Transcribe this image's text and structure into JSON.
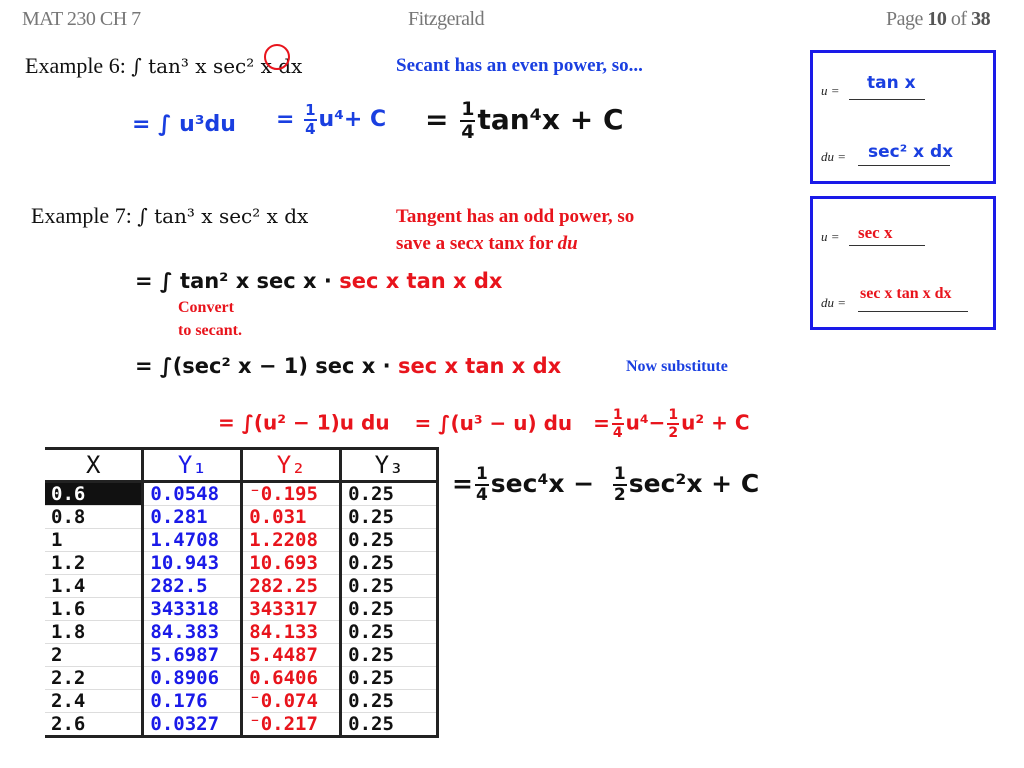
{
  "header": {
    "course": "MAT 230 CH 7",
    "author": "Fitzgerald",
    "page_prefix": "Page",
    "page_current": "10",
    "page_of": "of",
    "page_total": "38"
  },
  "example6": {
    "label": "Example 6:",
    "integrand": "∫ tan³ x sec² x dx",
    "note": "Secant has an even power, so...",
    "step1": "= ∫ u³du",
    "step2_eq": "=",
    "step2_num": "1",
    "step2_den": "4",
    "step2_rest": "u⁴+ C",
    "final_eq": "=",
    "final_num": "1",
    "final_den": "4",
    "final_rest": "tan⁴x + C",
    "sub_box": {
      "u_label": "u =",
      "u_value": "tan x",
      "du_label": "du =",
      "du_value": "sec² x dx"
    }
  },
  "example7": {
    "label": "Example 7:",
    "integrand": "∫ tan³ x sec² x dx",
    "note_line1": "Tangent has an odd power, so",
    "note_line2_a": "save a sec",
    "note_line2_b": "x",
    "note_line2_c": " tan",
    "note_line2_d": "x",
    "note_line2_e": " for ",
    "note_line2_f": "du",
    "line1_black": "= ∫ tan² x sec x ·",
    "line1_red": "sec x tan x dx",
    "convert_note_1": "Convert",
    "convert_note_2": "to secant.",
    "line2_black": "= ∫(sec² x − 1) sec x ·",
    "line2_red": "sec x tan x dx",
    "substitute_note": "Now substitute",
    "line3_a": "= ∫(u² − 1)u du",
    "line3_b": "= ∫(u³ − u) du",
    "line3_c_eq": "=",
    "line3_c_f1_num": "1",
    "line3_c_f1_den": "4",
    "line3_c_mid": "u⁴−",
    "line3_c_f2_num": "1",
    "line3_c_f2_den": "2",
    "line3_c_end": "u² + C",
    "final_eq": "=",
    "final_f1_num": "1",
    "final_f1_den": "4",
    "final_mid": "sec⁴x −",
    "final_f2_num": "1",
    "final_f2_den": "2",
    "final_end": "sec²x + C",
    "sub_box": {
      "u_label": "u =",
      "u_value": "sec x",
      "du_label": "du =",
      "du_value": "sec x tan x dx"
    }
  },
  "calculator_table": {
    "headers": [
      "X",
      "Y₁",
      "Y₂",
      "Y₃"
    ],
    "header_colors": [
      "#111111",
      "#1a1ae8",
      "#e8141c",
      "#111111"
    ],
    "selected_row": 0,
    "rows": [
      [
        "0.6",
        "0.0548",
        "⁻0.195",
        "0.25"
      ],
      [
        "0.8",
        "0.281",
        "0.031",
        "0.25"
      ],
      [
        "1",
        "1.4708",
        "1.2208",
        "0.25"
      ],
      [
        "1.2",
        "10.943",
        "10.693",
        "0.25"
      ],
      [
        "1.4",
        "282.5",
        "282.25",
        "0.25"
      ],
      [
        "1.6",
        "343318",
        "343317",
        "0.25"
      ],
      [
        "1.8",
        "84.383",
        "84.133",
        "0.25"
      ],
      [
        "2",
        "5.6987",
        "5.4487",
        "0.25"
      ],
      [
        "2.2",
        "0.8906",
        "0.6406",
        "0.25"
      ],
      [
        "2.4",
        "0.176",
        "⁻0.074",
        "0.25"
      ],
      [
        "2.6",
        "0.0327",
        "⁻0.217",
        "0.25"
      ]
    ]
  },
  "colors": {
    "blue": "#1a3fe0",
    "red": "#e8141c",
    "box_border": "#1a1ae8"
  }
}
